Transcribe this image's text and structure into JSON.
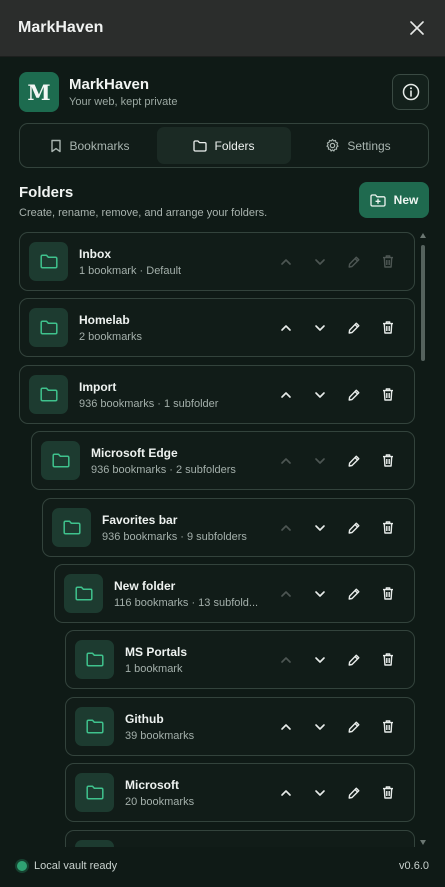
{
  "window": {
    "title": "MarkHaven"
  },
  "brand": {
    "logo_letter": "M",
    "name": "MarkHaven",
    "tagline": "Your web, kept private"
  },
  "tabs": [
    {
      "label": "Bookmarks",
      "icon": "bookmark-icon",
      "active": false
    },
    {
      "label": "Folders",
      "icon": "folder-icon",
      "active": true
    },
    {
      "label": "Settings",
      "icon": "gear-icon",
      "active": false
    }
  ],
  "folders_section": {
    "title": "Folders",
    "subtitle": "Create, rename, remove, and arrange your folders.",
    "new_label": "New"
  },
  "folders": [
    {
      "name": "Inbox",
      "sub": "1 bookmark · Default",
      "depth": 0,
      "up": false,
      "down": false,
      "edit": false,
      "del": false
    },
    {
      "name": "Homelab",
      "sub": "2 bookmarks",
      "depth": 0,
      "up": true,
      "down": true,
      "edit": true,
      "del": true
    },
    {
      "name": "Import",
      "sub": "936 bookmarks · 1 subfolder",
      "depth": 0,
      "up": true,
      "down": true,
      "edit": true,
      "del": true
    },
    {
      "name": "Microsoft Edge",
      "sub": "936 bookmarks · 2 subfolders",
      "depth": 1,
      "up": false,
      "down": false,
      "edit": true,
      "del": true
    },
    {
      "name": "Favorites bar",
      "sub": "936 bookmarks · 9 subfolders",
      "depth": 2,
      "up": false,
      "down": true,
      "edit": true,
      "del": true
    },
    {
      "name": "New folder",
      "sub": "116 bookmarks · 13 subfold...",
      "depth": 3,
      "up": false,
      "down": true,
      "edit": true,
      "del": true
    },
    {
      "name": "MS Portals",
      "sub": "1 bookmark",
      "depth": 4,
      "up": false,
      "down": true,
      "edit": true,
      "del": true
    },
    {
      "name": "Github",
      "sub": "39 bookmarks",
      "depth": 4,
      "up": true,
      "down": true,
      "edit": true,
      "del": true
    },
    {
      "name": "Microsoft",
      "sub": "20 bookmarks",
      "depth": 4,
      "up": true,
      "down": true,
      "edit": true,
      "del": true
    },
    {
      "name": "",
      "sub": "",
      "depth": 4,
      "up": true,
      "down": true,
      "edit": true,
      "del": true
    }
  ],
  "footer": {
    "status": "Local vault ready",
    "version": "v0.6.0"
  },
  "colors": {
    "accent": "#1f6a4f",
    "background": "#0f1a16",
    "border": "#33433c",
    "status_ok": "#2fa172"
  }
}
